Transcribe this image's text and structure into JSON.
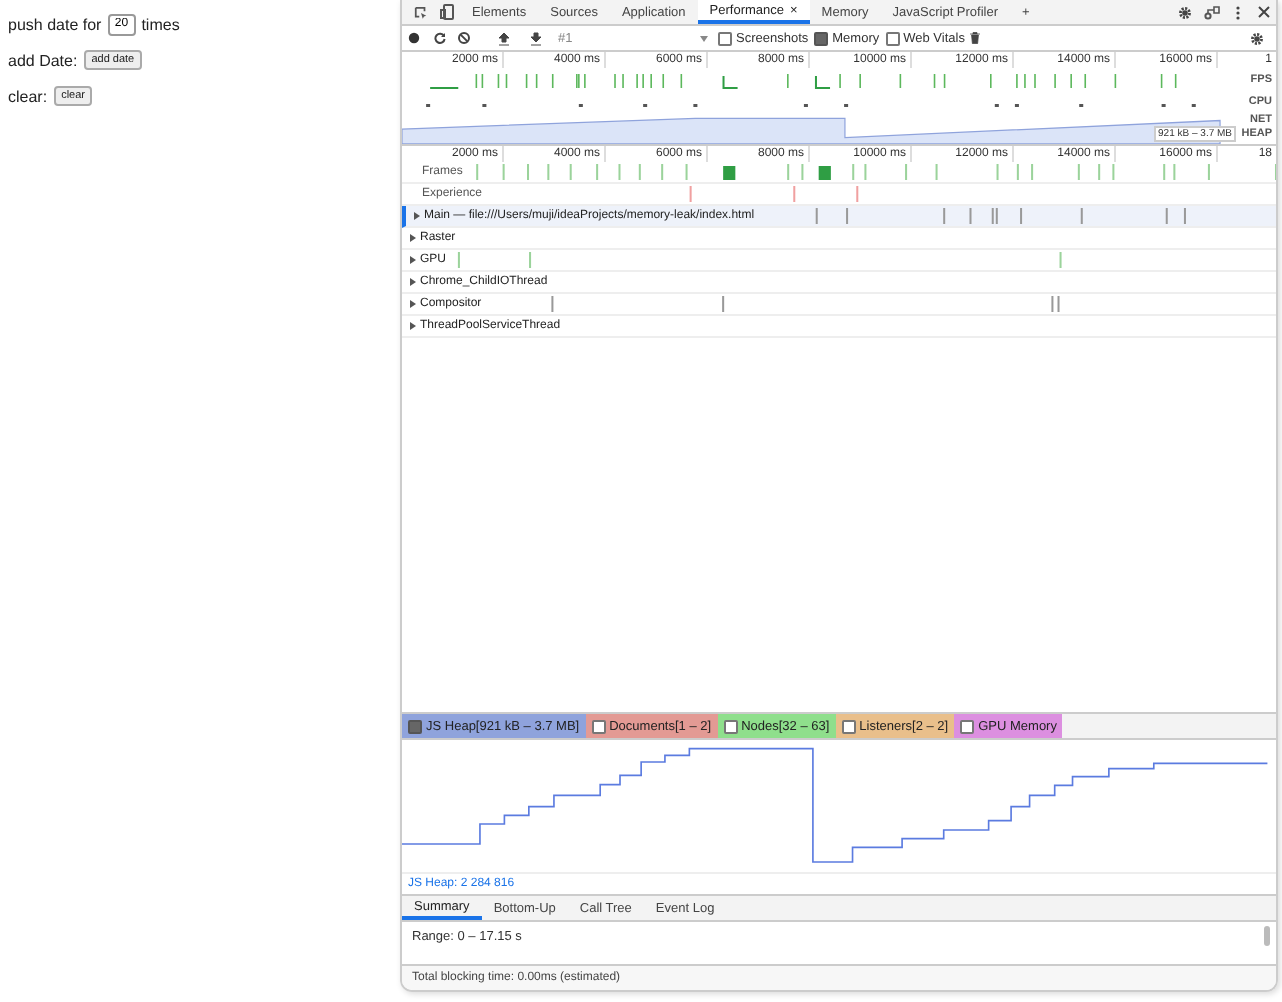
{
  "page": {
    "rows": [
      {
        "kind": "input",
        "label": "push date for",
        "value": "20",
        "suffix": "times"
      },
      {
        "kind": "button",
        "label": "add Date:",
        "button": "add date"
      },
      {
        "kind": "button",
        "label": "clear:",
        "button": "clear"
      }
    ]
  },
  "devtools": {
    "tabs": [
      {
        "label": "Elements",
        "selected": false
      },
      {
        "label": "Sources",
        "selected": false
      },
      {
        "label": "Application",
        "selected": false
      },
      {
        "label": "Performance",
        "selected": true,
        "close": "×"
      },
      {
        "label": "Memory",
        "selected": false
      },
      {
        "label": "JavaScript Profiler",
        "selected": false
      }
    ],
    "new_tab": "+",
    "toolbar": {
      "recording": "#1",
      "checkboxes": [
        {
          "label": "Screenshots",
          "checked": false
        },
        {
          "label": "Memory",
          "checked": true
        },
        {
          "label": "Web Vitals",
          "checked": false
        }
      ]
    },
    "overview": {
      "ticks": [
        "2000 ms",
        "4000 ms",
        "6000 ms",
        "8000 ms",
        "10000 ms",
        "12000 ms",
        "14000 ms",
        "16000 ms",
        "1"
      ],
      "lanes": [
        "FPS",
        "CPU",
        "NET",
        "HEAP"
      ],
      "heap_range": "921 kB – 3.7 MB"
    },
    "timeline": {
      "ticks": [
        "2000 ms",
        "4000 ms",
        "6000 ms",
        "8000 ms",
        "10000 ms",
        "12000 ms",
        "14000 ms",
        "16000 ms",
        "18"
      ],
      "tracks": [
        {
          "kind": "lane",
          "label": "Frames",
          "selected": false
        },
        {
          "kind": "lane",
          "label": "Experience",
          "selected": false
        },
        {
          "kind": "group",
          "label": "Main — file:///Users/muji/ideaProjects/memory-leak/index.html",
          "selected": true
        },
        {
          "kind": "group",
          "label": "Raster",
          "selected": false
        },
        {
          "kind": "group",
          "label": "GPU",
          "selected": false
        },
        {
          "kind": "group",
          "label": "Chrome_ChildIOThread",
          "selected": false
        },
        {
          "kind": "group",
          "label": "Compositor",
          "selected": false
        },
        {
          "kind": "group",
          "label": "ThreadPoolServiceThread",
          "selected": false
        }
      ]
    },
    "counters": [
      {
        "label": "JS Heap[921 kB – 3.7 MB]",
        "checked": true,
        "color": "#8fa3dc"
      },
      {
        "label": "Documents[1 – 2]",
        "checked": false,
        "color": "#e39a94"
      },
      {
        "label": "Nodes[32 – 63]",
        "checked": false,
        "color": "#8fdf8c"
      },
      {
        "label": "Listeners[2 – 2]",
        "checked": false,
        "color": "#e9bf8b"
      },
      {
        "label": "GPU Memory",
        "checked": false,
        "color": "#dc8fe0"
      }
    ],
    "heap_readout": "JS Heap: 2 284 816",
    "bottom_tabs": [
      {
        "label": "Summary",
        "selected": true
      },
      {
        "label": "Bottom-Up",
        "selected": false
      },
      {
        "label": "Call Tree",
        "selected": false
      },
      {
        "label": "Event Log",
        "selected": false
      }
    ],
    "range": "Range: 0 – 17.15 s",
    "footer": "Total blocking time: 0.00ms (estimated)"
  }
}
